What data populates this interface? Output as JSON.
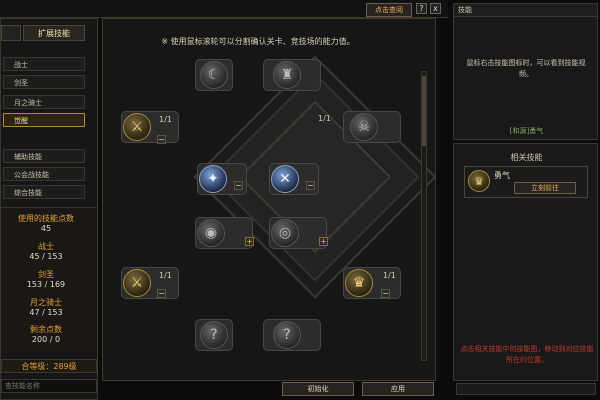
{
  "window": {
    "title_button": "点击查阅",
    "help_icon": "?",
    "close_icon": "x"
  },
  "left": {
    "tabs": [
      "",
      "扩展技能"
    ],
    "class_items": [
      "战士",
      "剑圣",
      "月之骑士",
      "觉醒"
    ],
    "misc_items": [
      "辅助技能",
      "公会战技能",
      "综合技能"
    ],
    "points_used_label": "使用的技能点数",
    "points_used_value": "45",
    "stats": [
      {
        "label": "战士",
        "value": "45 / 153"
      },
      {
        "label": "剑圣",
        "value": "153 / 169"
      },
      {
        "label": "月之骑士",
        "value": "47 / 153"
      },
      {
        "label": "剩余点数",
        "value": "200 / 0"
      }
    ],
    "level_text": "合等级：289级",
    "search_placeholder": "查技能名称"
  },
  "center": {
    "hint": "※ 使用鼠标滚轮可以分割确认关卡、竞技场的能力值。",
    "levels": [
      "1/1",
      "1/1",
      "1/1",
      "1/1"
    ],
    "reset_button": "初始化",
    "apply_button": "应用"
  },
  "right_top": {
    "title": "技能",
    "description": "鼠标右击技能图标时，可以看到技能视频。",
    "skill_link": "[和源]勇气"
  },
  "right_mid": {
    "title": "相关技能",
    "skill_name": "勇气",
    "learn_button": "立刻前往",
    "note": "点击相关技能中的技能图，移动到对应技能所在的位置。"
  },
  "colors": {
    "accent_gold": "#e0a33b",
    "note_red": "#c0392b",
    "link_green": "#7fae5a"
  }
}
